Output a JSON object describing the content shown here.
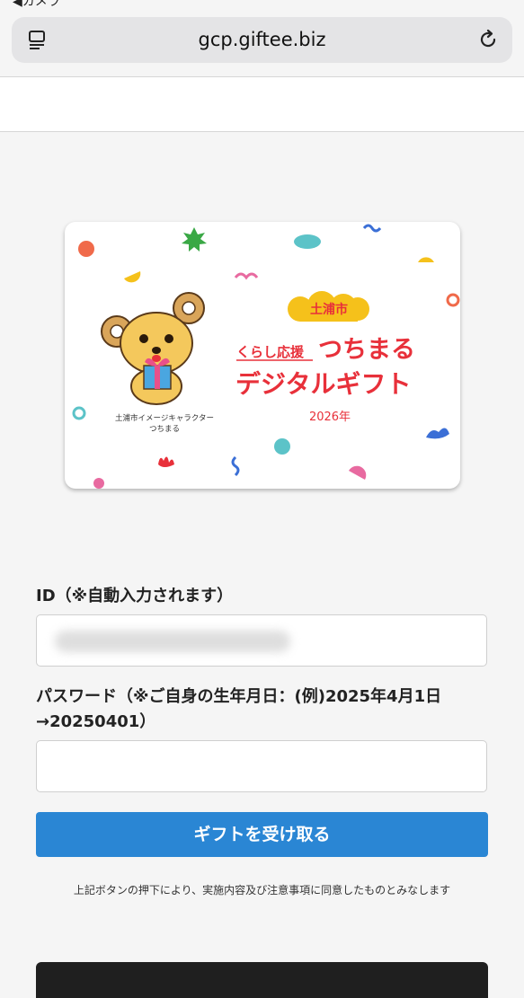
{
  "browser": {
    "back_label": "◀カメラ",
    "url": "gcp.giftee.biz",
    "icons": [
      "reader-icon",
      "reload-icon"
    ]
  },
  "card": {
    "city_badge": "土浦市",
    "line1_prefix": "くらし応援",
    "line1_main": "つちまる",
    "line2": "デジタルギフト",
    "year": "2026年",
    "character_caption_1": "土浦市イメージキャラクター",
    "character_caption_2": "つちまる",
    "colors": {
      "red": "#e8303a",
      "yellow": "#f5c11b"
    }
  },
  "form": {
    "id_label": "ID（※自動入力されます）",
    "id_value": "●●●●●●●●●●●●●●●●",
    "password_label_line1": "パスワード（※ご自身の生年月日：(例)2025年4月1日",
    "password_label_line2": "→20250401）",
    "password_value": "",
    "submit_label": "ギフトを受け取る",
    "submit_color": "#2a86d4",
    "note": "上記ボタンの押下により、実施内容及び注意事項に同意したものとみなします"
  }
}
